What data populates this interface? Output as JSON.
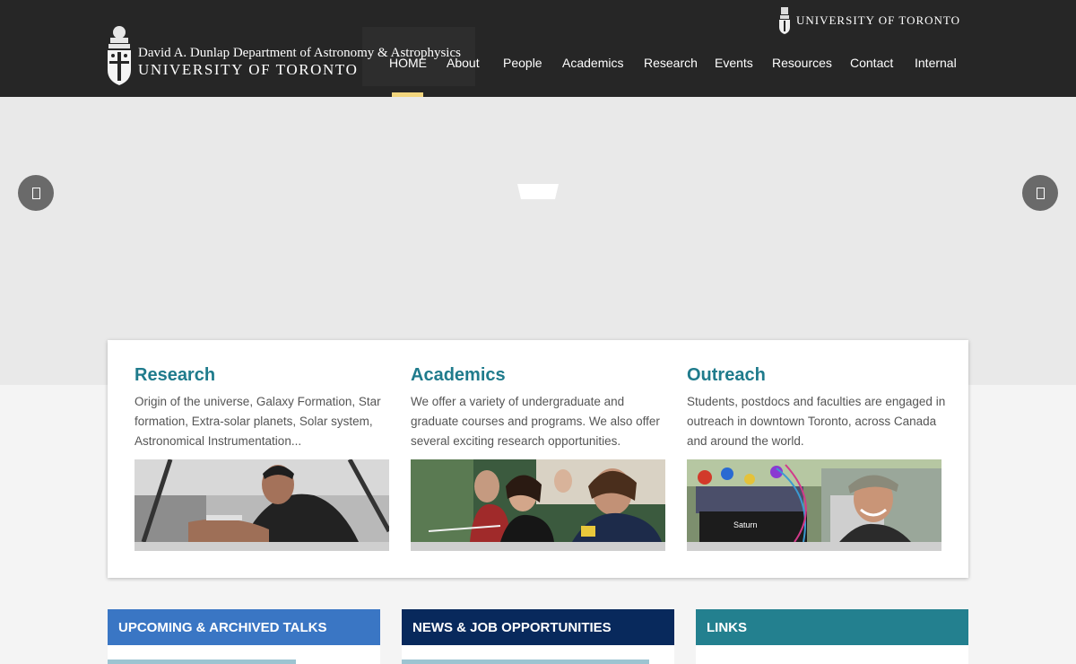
{
  "header": {
    "university_top": "UNIVERSITY OF TORONTO",
    "logo_dept": "David A. Dunlap Department of Astronomy & Astrophysics",
    "logo_univ": "UNIVERSITY OF TORONTO",
    "nav": [
      {
        "label": "HOME",
        "active": true
      },
      {
        "label": "About"
      },
      {
        "label": "People"
      },
      {
        "label": "Academics"
      },
      {
        "label": "Research"
      },
      {
        "label": "Events"
      },
      {
        "label": "Resources"
      },
      {
        "label": "Contact"
      },
      {
        "label": "Internal"
      }
    ]
  },
  "hero": {
    "prev_icon": "chevron-left-icon",
    "next_icon": "chevron-right-icon"
  },
  "cards": [
    {
      "title": "Research",
      "text": "Origin of the universe, Galaxy Formation, Star formation, Extra-solar planets, Solar system, Astronomical Instrumentation..."
    },
    {
      "title": "Academics",
      "text": "We offer a variety of undergraduate and graduate courses and programs. We also offer several exciting research opportunities."
    },
    {
      "title": "Outreach",
      "text": "Students, postdocs and faculties are engaged in outreach in downtown Toronto, across Canada and around the world.",
      "photo_sign": "Saturn"
    }
  ],
  "sections": [
    {
      "title": "UPCOMING & ARCHIVED TALKS",
      "color": "#3a76c4"
    },
    {
      "title": "NEWS & JOB OPPORTUNITIES",
      "color": "#08295c"
    },
    {
      "title": "LINKS",
      "color": "#23808f"
    }
  ],
  "colors": {
    "topbar": "#262626",
    "accent_teal": "#1f7b8c",
    "active_underline": "#f2d57d"
  }
}
